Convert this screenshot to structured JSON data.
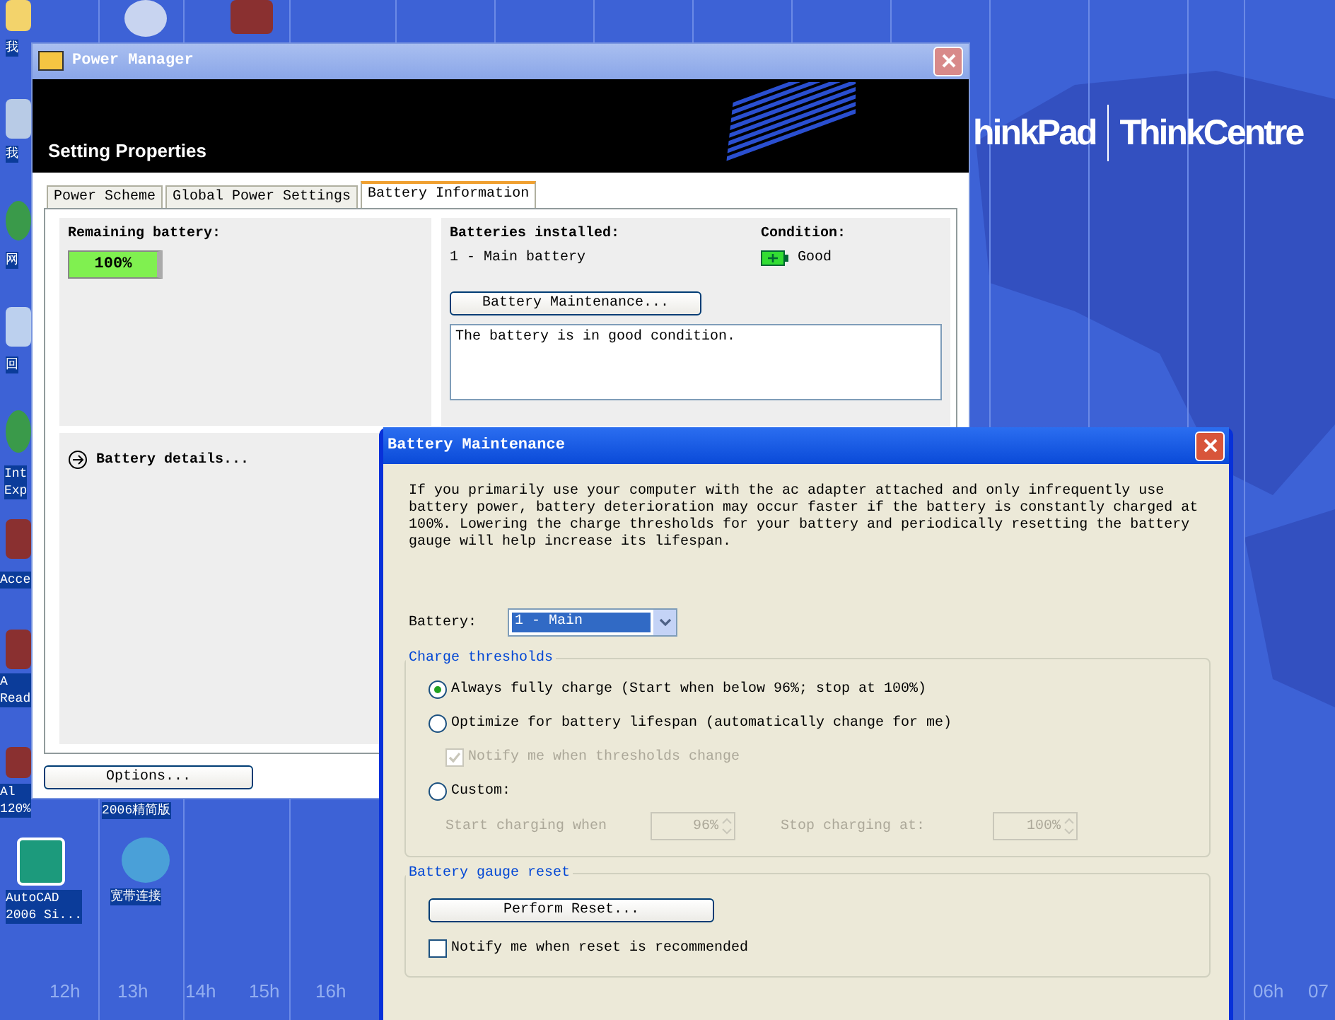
{
  "desktop": {
    "icons": [
      {
        "label": "我",
        "kind": "folder"
      },
      {
        "label": "我",
        "kind": "computer"
      },
      {
        "label": "网",
        "kind": "globe"
      },
      {
        "label": "回",
        "kind": "bin"
      },
      {
        "label": "Int\nExp",
        "kind": "globe"
      },
      {
        "label": "Acce",
        "kind": "app"
      },
      {
        "label": "A\nRead",
        "kind": "app"
      },
      {
        "label": "Al\n120%",
        "kind": "app"
      },
      {
        "label": "2006精简版",
        "kind": "none"
      },
      {
        "label": "AutoCAD\n2006 Si...",
        "kind": "cad"
      },
      {
        "label": "宽带连接",
        "kind": "network"
      },
      {
        "kind": "bolt"
      },
      {
        "kind": "app"
      }
    ],
    "brand": [
      "hinkPad",
      "ThinkCentre"
    ],
    "timeline": [
      "12h",
      "13h",
      "14h",
      "15h",
      "16h",
      "06h",
      "07"
    ]
  },
  "power_manager": {
    "title": "Power Manager",
    "header": "Setting Properties",
    "tabs": [
      {
        "label": "Power Scheme",
        "selected": false
      },
      {
        "label": "Global Power Settings",
        "selected": false
      },
      {
        "label": "Battery Information",
        "selected": true
      }
    ],
    "remaining": {
      "label": "Remaining battery:",
      "level": 1,
      "reading": "100%"
    },
    "installed": {
      "label": "Batteries installed:",
      "value": "1 - Main battery"
    },
    "condition": {
      "label": "Condition:",
      "value": "Good"
    },
    "maintenance_button": "Battery Maintenance...",
    "message": "The battery is in good condition.",
    "details": "Battery details...",
    "options_button": "Options..."
  },
  "dialog": {
    "title": "Battery Maintenance",
    "description": "If you primarily use your computer with the ac adapter attached and only infrequently use battery power, battery deterioration may occur faster if the battery is constantly charged at 100%. Lowering the charge thresholds for your battery and periodically resetting the battery gauge will help increase its lifespan.",
    "battery_label": "Battery:",
    "battery_value": "1 - Main",
    "charge_thresholds": {
      "title": "Charge thresholds",
      "options": [
        {
          "label": "Always fully charge (Start when below 96%; stop at 100%)",
          "selected": true
        },
        {
          "label": "Optimize for battery lifespan (automatically change for me)",
          "selected": false
        },
        {
          "label": "Custom:",
          "selected": false
        }
      ],
      "notify": {
        "label": "Notify me when thresholds change",
        "checked": true,
        "disabled": true
      },
      "start": {
        "label": "Start charging when",
        "value": "96%"
      },
      "stop": {
        "label": "Stop charging at:",
        "value": "100%"
      }
    },
    "gauge_reset": {
      "title": "Battery gauge reset",
      "button": "Perform Reset...",
      "notify": {
        "label": "Notify me when reset is recommended",
        "checked": false,
        "disabled": false
      }
    }
  }
}
